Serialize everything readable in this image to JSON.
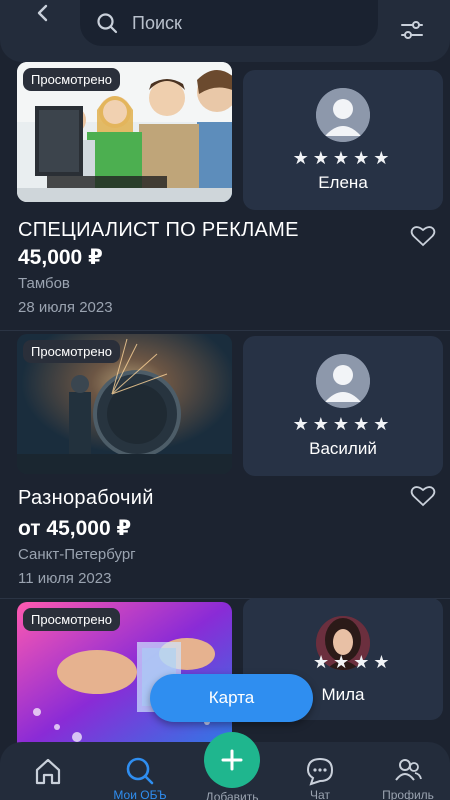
{
  "header": {
    "search_placeholder": "Поиск",
    "icons": [
      "back-icon",
      "search-icon",
      "filter-icon"
    ]
  },
  "listings": [
    {
      "viewed_badge": "Просмотрено",
      "photo": "students-at-computers",
      "seller": {
        "name": "Елена",
        "stars": "★★★★★",
        "avatar": "default-user-icon"
      },
      "title": "СПЕЦИАЛИСТ ПО РЕКЛАМЕ",
      "price": "45,000 ₽",
      "city": "Тамбов",
      "date": "28 июля 2023"
    },
    {
      "viewed_badge": "Просмотрено",
      "photo": "worker-grinding-metal",
      "seller": {
        "name": "Василий",
        "stars": "★★★★★",
        "avatar": "default-user-icon"
      },
      "title": "Разнорабочий",
      "price": "от 45,000 ₽",
      "city": "Санкт-Петербург",
      "date": "11 июля 2023"
    },
    {
      "viewed_badge": "Просмотрено",
      "photo": "bartender-pouring-ice",
      "seller": {
        "name": "Мила",
        "stars": "★★★★",
        "avatar": "woman-photo"
      }
    }
  ],
  "map_button": "Карта",
  "nav": {
    "home": "Главная",
    "search": "Мои ОБЪ",
    "add": "Добавить",
    "chat": "Чат",
    "profile": "Профиль"
  },
  "colors": {
    "background": "#1c2330",
    "card": "#273245",
    "accent_blue": "#2f8ef0",
    "accent_green": "#1fb68e"
  }
}
